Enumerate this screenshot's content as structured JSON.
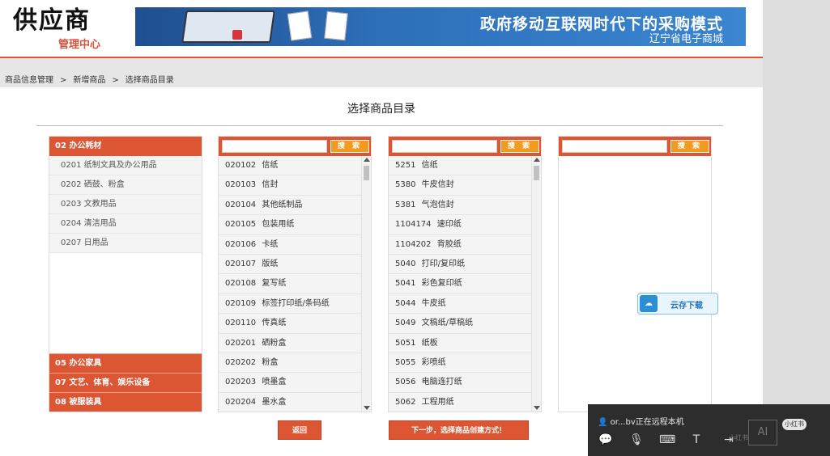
{
  "header": {
    "logo_main": "供应商",
    "logo_sub": "管理中心",
    "banner_title": "政府移动互联网时代下的采购模式",
    "banner_sub": "辽宁省电子商城"
  },
  "breadcrumb": [
    "商品信息管理",
    "新增商品",
    "选择商品目录"
  ],
  "breadcrumb_sep": ">",
  "page_title": "选择商品目录",
  "categories": {
    "active": "02 办公耗材",
    "sub_items": [
      "0201 纸制文具及办公用品",
      "0202 硒鼓、粉盒",
      "0203 文教用品",
      "0204 清洁用品",
      "0207 日用品"
    ],
    "others": [
      "05 办公家具",
      "07 文艺、体育、娱乐设备",
      "08 被服装具"
    ]
  },
  "search": {
    "button_label": "搜 索",
    "placeholder": ""
  },
  "list1": [
    {
      "code": "020102",
      "name": "信纸"
    },
    {
      "code": "020103",
      "name": "信封"
    },
    {
      "code": "020104",
      "name": "其他纸制品"
    },
    {
      "code": "020105",
      "name": "包装用纸"
    },
    {
      "code": "020106",
      "name": "卡纸"
    },
    {
      "code": "020107",
      "name": "版纸"
    },
    {
      "code": "020108",
      "name": "复写纸"
    },
    {
      "code": "020109",
      "name": "标签打印纸/条码纸"
    },
    {
      "code": "020110",
      "name": "传真纸"
    },
    {
      "code": "020201",
      "name": "硒粉盒"
    },
    {
      "code": "020202",
      "name": "粉盒"
    },
    {
      "code": "020203",
      "name": "喷墨盒"
    },
    {
      "code": "020204",
      "name": "墨水盒"
    }
  ],
  "list2": [
    {
      "code": "5251",
      "name": "信纸"
    },
    {
      "code": "5380",
      "name": "牛皮信封"
    },
    {
      "code": "5381",
      "name": "气泡信封"
    },
    {
      "code": "1104174",
      "name": "速印纸"
    },
    {
      "code": "1104202",
      "name": "背胶纸"
    },
    {
      "code": "5040",
      "name": "打印/复印纸"
    },
    {
      "code": "5041",
      "name": "彩色复印纸"
    },
    {
      "code": "5044",
      "name": "牛皮纸"
    },
    {
      "code": "5049",
      "name": "文稿纸/草稿纸"
    },
    {
      "code": "5051",
      "name": "纸板"
    },
    {
      "code": "5055",
      "name": "彩喷纸"
    },
    {
      "code": "5056",
      "name": "电脑连打纸"
    },
    {
      "code": "5062",
      "name": "工程用纸"
    }
  ],
  "buttons": {
    "back": "返回",
    "next": "下一步，选择商品创建方式！"
  },
  "cloud_download": "云存下载",
  "remote": {
    "status": "or...bv正在远程本机",
    "ai_label": "AI",
    "badge": "小红书",
    "watermark": "小红书"
  },
  "colors": {
    "accent": "#dc5634",
    "search_button": "#f29b20"
  }
}
